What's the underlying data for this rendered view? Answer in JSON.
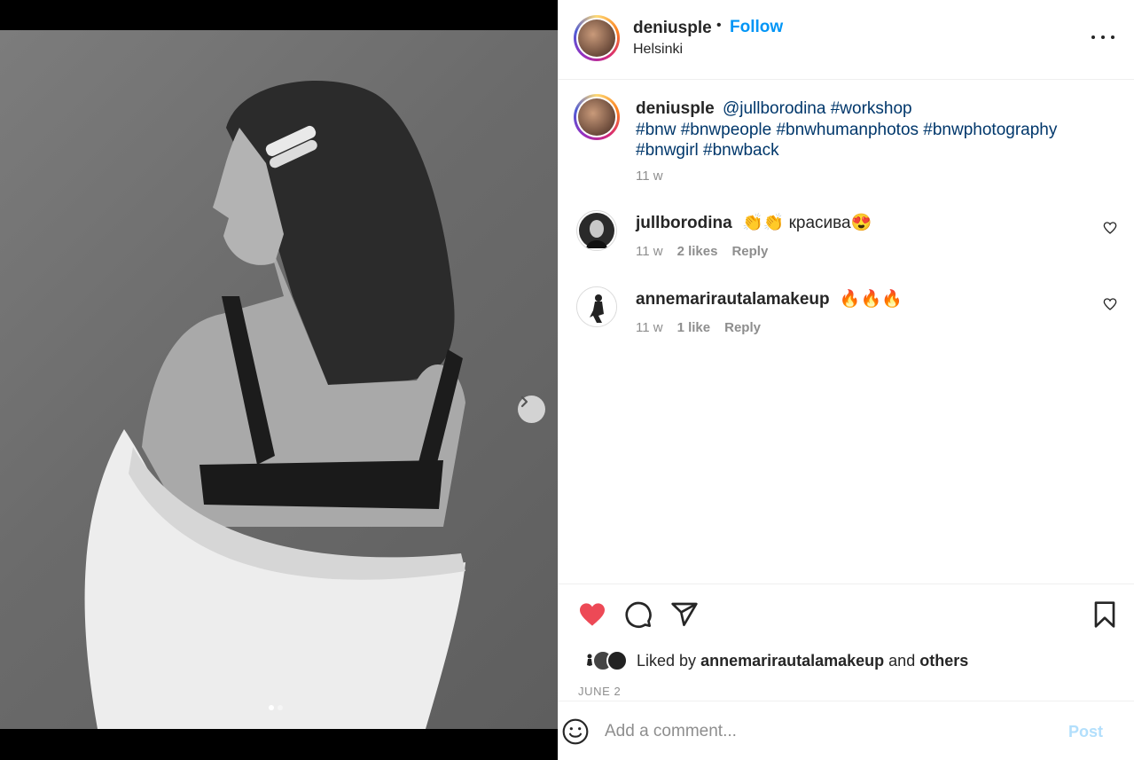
{
  "post": {
    "author": "deniusple",
    "follow_label": "Follow",
    "separator": "•",
    "location": "Helsinki",
    "photo_description_icon": "bw-portrait-photo",
    "carousel": {
      "count": 2,
      "active": 0
    }
  },
  "caption": {
    "username": "deniusple",
    "mention": "@jullborodina",
    "line1_tag": "#workshop",
    "line2": "#bnw #bnwpeople #bnwhumanphotos #bnwphotography",
    "line3": "#bnwgirl #bnwback",
    "time": "11 w"
  },
  "comments": [
    {
      "username": "jullborodina",
      "text": "👏👏 красива😍",
      "time": "11 w",
      "likes": "2 likes",
      "reply": "Reply"
    },
    {
      "username": "annemarirautalamakeup",
      "text": "🔥🔥🔥",
      "time": "11 w",
      "likes": "1 like",
      "reply": "Reply"
    }
  ],
  "actions": {
    "liked_prefix": "Liked by",
    "liked_user": "annemarirautalamakeup",
    "liked_and": "and",
    "liked_others": "others",
    "date": "JUNE 2",
    "liked": true
  },
  "add_comment": {
    "placeholder": "Add a comment...",
    "post_label": "Post"
  },
  "colors": {
    "accent": "#0095f6",
    "hashtag": "#00376b",
    "like_red": "#ed4956",
    "muted": "#8e8e8e",
    "post_disabled": "#b2dffc"
  }
}
